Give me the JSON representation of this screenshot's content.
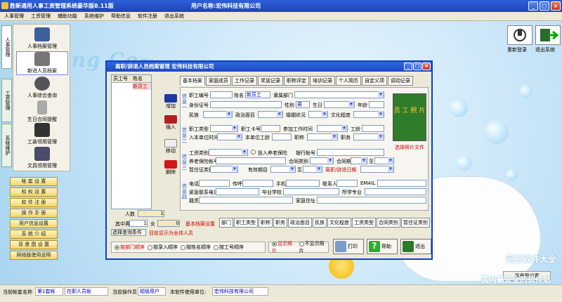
{
  "window": {
    "title": "胜新通用人事工资管理系统豪华版8.11版",
    "user_label": "用户名称:宏伟科技有限公司"
  },
  "menu": [
    "人事管理",
    "工资管理",
    "辅助功能",
    "系统维护",
    "帮助信息",
    "软件注册",
    "退出系统"
  ],
  "background": {
    "logo": "ing Co~"
  },
  "sidebar": {
    "tabs": [
      "人事管理",
      "工资管理",
      "系统维护"
    ],
    "items": [
      "人事档案管理",
      "新进人员档案",
      "人事综合查询",
      "生日合同提醒",
      "工装领用管理",
      "文具领用管理"
    ],
    "buttons": [
      "帐 套 设 置",
      "权 权 设 置",
      "软 件 注 册",
      "操 作 手 册",
      "用户信息设置",
      "系 统 介 绍",
      "背 景 图 设 置",
      "网络版使用说明"
    ]
  },
  "top_right": {
    "relogin": "重新登录",
    "exit": "退出系统"
  },
  "dialog": {
    "title": "离职/辞退人员档案管理     宏伟科技有限公司",
    "list_headers": [
      "员工号",
      "姓名"
    ],
    "list_rows": [
      {
        "name": "新员工"
      }
    ],
    "ops": [
      "增加",
      "插入",
      "移动",
      "删除"
    ],
    "tabs": [
      "基本档案",
      "家庭成员",
      "工作记录",
      "奖惩记录",
      "职称评定",
      "培训记录",
      "个人简历",
      "自定义项",
      "调动记录"
    ],
    "sections": [
      "信息一",
      "信息二",
      "信息三",
      "信息四"
    ],
    "labels": {
      "emp_no": "职工编号",
      "name": "姓名",
      "dept": "隶属部门",
      "id_card": "身份证号",
      "gender": "性别",
      "birthday": "生日",
      "age": "年龄",
      "ethnicity": "民族",
      "political": "政治面目",
      "marital": "婚姻状况",
      "education": "文化程度",
      "emp_type": "职工类型",
      "card_no": "职工卡号",
      "join_time": "参加工作时间",
      "seniority": "工龄",
      "join_unit": "入本单位时间",
      "unit_seniority": "本单位工龄",
      "title": "职称",
      "position": "职务",
      "wage_type": "工资类别",
      "insured": "投入养老保险",
      "bank_acct": "银行帐号",
      "pension_acct": "养老保险帐号",
      "contract_type": "合同类别",
      "contract_period": "合同期",
      "to": "至",
      "temp_cert": "暂住证类别",
      "valid_period": "有效期目",
      "resign_date": "离职/辞退日期",
      "phone": "电话",
      "pager": "传呼",
      "mobile": "手机",
      "contact": "联系人",
      "email": "EMAIL",
      "emergency": "紧急联系电话",
      "school": "毕业学校",
      "major": "所学专业",
      "origin": "籍贯",
      "address": "家庭住址"
    },
    "values": {
      "name": "新员工",
      "gender": "男"
    },
    "photo_text": "员 工 照 片",
    "photo_button": "选择照片文件",
    "count_label": "人数",
    "count_value": "1",
    "male_label": "其中男",
    "male_value": "1",
    "female_label": "女",
    "female_value": "0",
    "settings_note": "基本档案设置",
    "bottom_tabs": [
      "部门",
      "职工类型",
      "职称",
      "职务",
      "政治面目",
      "民族",
      "文化程度",
      "工资类型",
      "合同类别",
      "暂住证类别"
    ],
    "query_button": "选择查询条件",
    "query_status": "目前显示为全体人员",
    "sort_options": [
      "按部门顺序",
      "按录入顺序",
      "按姓名顺序",
      "按工号顺序"
    ],
    "photo_options": [
      "显示照片",
      "不显示照片"
    ],
    "print": "打印",
    "help": "帮助",
    "exit": "退出"
  },
  "status_bar": {
    "account_label": "当前帐套名称",
    "account_value": "第1套帐",
    "mode_value": "在职人员帐",
    "operator_label": "当前操作员",
    "operator_value": "超级用户",
    "unit_label": "本软件使用单位:",
    "unit_value": "宏伟科技有限公司"
  },
  "background_button": "背景图设置",
  "watermark": [
    "河东软件大全",
    "国内最安全的软件站"
  ],
  "colors": {
    "titlebar": "#2b5fd9",
    "accent_red": "#cc0000",
    "field_border": "#7f9db9"
  }
}
